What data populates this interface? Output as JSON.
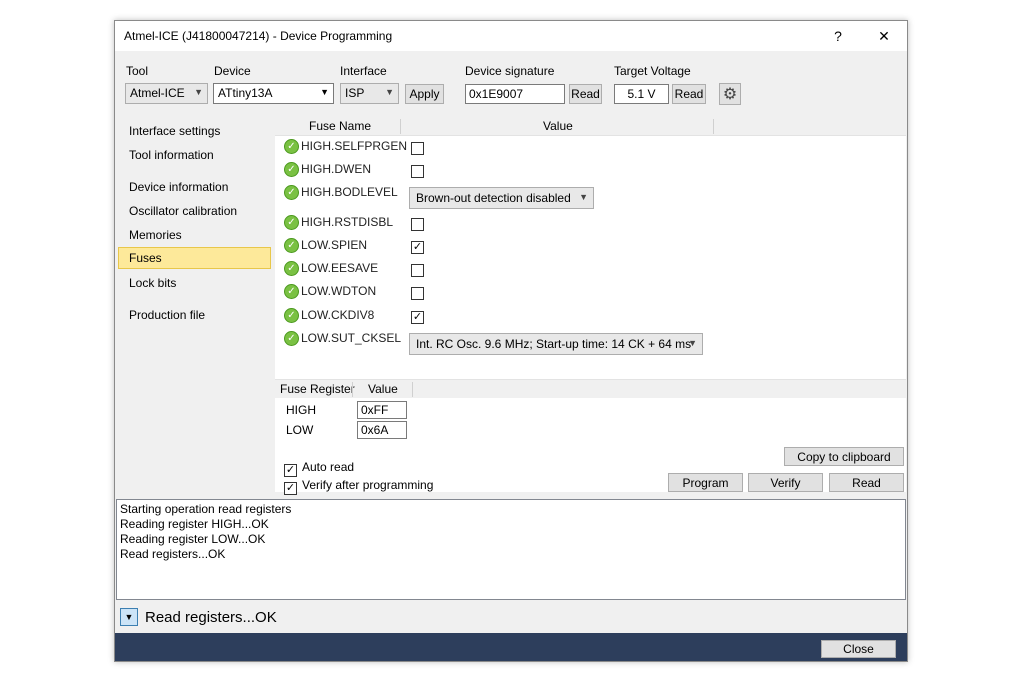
{
  "window": {
    "title": "Atmel-ICE (J41800047214) - Device Programming",
    "help": "?",
    "close": "✕"
  },
  "header": {
    "tool_label": "Tool",
    "tool_value": "Atmel-ICE",
    "device_label": "Device",
    "device_value": "ATtiny13A",
    "interface_label": "Interface",
    "interface_value": "ISP",
    "apply": "Apply",
    "signature_label": "Device signature",
    "signature_value": "0x1E9007",
    "signature_read": "Read",
    "voltage_label": "Target Voltage",
    "voltage_value": "5.1 V",
    "voltage_read": "Read"
  },
  "nav": {
    "items": [
      {
        "label": "Interface settings",
        "active": false
      },
      {
        "label": "Tool information",
        "active": false
      },
      {
        "label": "Device information",
        "active": false
      },
      {
        "label": "Oscillator calibration",
        "active": false
      },
      {
        "label": "Memories",
        "active": false
      },
      {
        "label": "Fuses",
        "active": true
      },
      {
        "label": "Lock bits",
        "active": false
      },
      {
        "label": "Production file",
        "active": false
      }
    ]
  },
  "fuses": {
    "col_name": "Fuse Name",
    "col_value": "Value",
    "rows": [
      {
        "name": "HIGH.SELFPRGEN",
        "type": "checkbox",
        "checked": false
      },
      {
        "name": "HIGH.DWEN",
        "type": "checkbox",
        "checked": false
      },
      {
        "name": "HIGH.BODLEVEL",
        "type": "combo",
        "value": "Brown-out detection disabled"
      },
      {
        "name": "HIGH.RSTDISBL",
        "type": "checkbox",
        "checked": false
      },
      {
        "name": "LOW.SPIEN",
        "type": "checkbox",
        "checked": true
      },
      {
        "name": "LOW.EESAVE",
        "type": "checkbox",
        "checked": false
      },
      {
        "name": "LOW.WDTON",
        "type": "checkbox",
        "checked": false
      },
      {
        "name": "LOW.CKDIV8",
        "type": "checkbox",
        "checked": true
      },
      {
        "name": "LOW.SUT_CKSEL",
        "type": "combo",
        "value": "Int. RC Osc. 9.6 MHz; Start-up time: 14 CK + 64 ms"
      }
    ]
  },
  "registers": {
    "col_register": "Fuse Register",
    "col_value": "Value",
    "rows": [
      {
        "name": "HIGH",
        "value": "0xFF"
      },
      {
        "name": "LOW",
        "value": "0x6A"
      }
    ]
  },
  "options": {
    "copy": "Copy to clipboard",
    "auto_read": "Auto read",
    "auto_read_checked": true,
    "verify_after": "Verify after programming",
    "verify_after_checked": true,
    "program": "Program",
    "verify": "Verify",
    "read": "Read"
  },
  "log": {
    "lines": [
      "Starting operation read registers",
      "Reading register HIGH...OK",
      "Reading register LOW...OK",
      "Read registers...OK"
    ]
  },
  "status": {
    "text": "Read registers...OK"
  },
  "footer": {
    "close": "Close"
  }
}
